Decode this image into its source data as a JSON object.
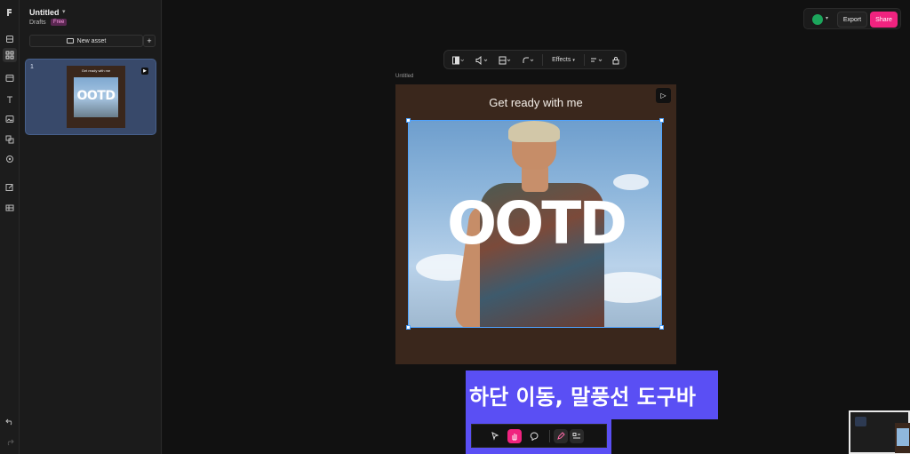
{
  "document": {
    "title": "Untitled",
    "location": "Drafts",
    "plan_badge": "Free"
  },
  "assets_panel": {
    "new_asset_label": "New asset",
    "add_label": "+",
    "pages": [
      {
        "number": "1",
        "thumbnail_heading": "Get ready with me",
        "thumbnail_text": "OOTD"
      }
    ]
  },
  "rail_icons": [
    "logo-icon",
    "layers-icon",
    "grid-icon",
    "template-icon",
    "text-icon",
    "image-icon",
    "shapes-icon",
    "record-icon",
    "edit-icon",
    "table-icon",
    "undo-icon",
    "redo-icon"
  ],
  "header_actions": {
    "export_label": "Export",
    "share_label": "Share",
    "share_color": "#f0237f"
  },
  "toolbar": {
    "effects_label": "Effects"
  },
  "canvas": {
    "frame_label": "Untitled",
    "heading": "Get ready with me",
    "overlay_text": "OOTD",
    "background_color": "#3a271c",
    "selection_color": "#4ea3ff"
  },
  "annotation": {
    "text": "하단 이동, 말풍선 도구바",
    "color": "#5a4ff4"
  },
  "bottom_toolbar": {
    "tools": [
      "pointer-icon",
      "hand-icon",
      "comment-icon",
      "pen-icon",
      "code-icon"
    ],
    "active_tool": "hand-icon"
  }
}
